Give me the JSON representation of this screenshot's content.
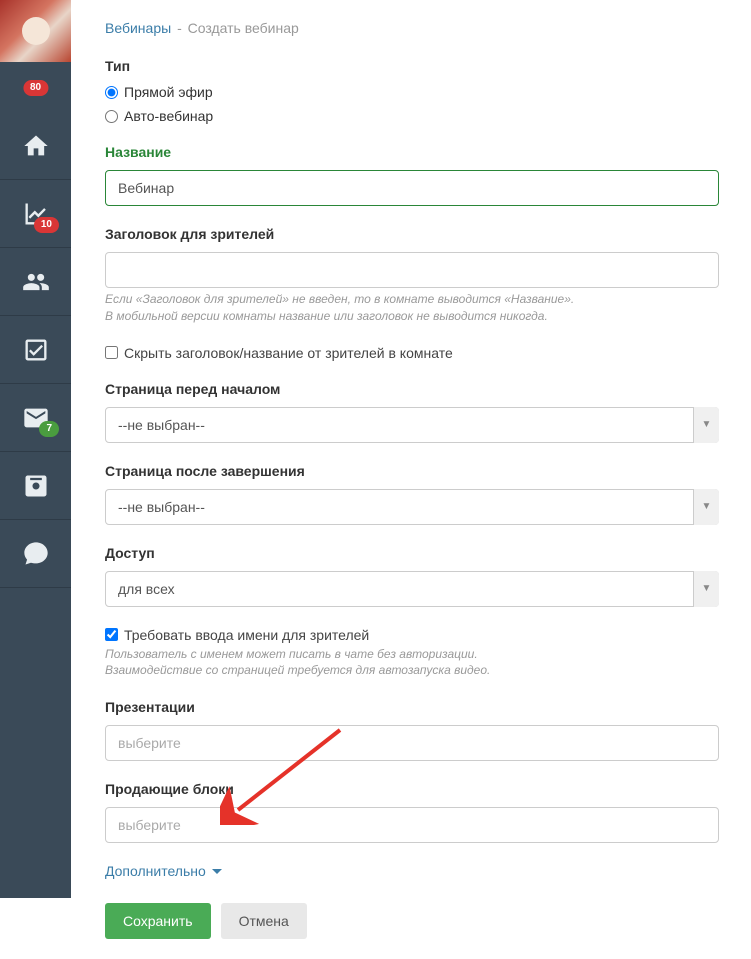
{
  "sidebar": {
    "badge1": "80",
    "badge_chart": "10",
    "badge_mail": "7"
  },
  "breadcrumb": {
    "link": "Вебинары",
    "sep": "-",
    "current": "Создать вебинар"
  },
  "type": {
    "label": "Тип",
    "options": [
      {
        "label": "Прямой эфир",
        "checked": true
      },
      {
        "label": "Авто-вебинар",
        "checked": false
      }
    ]
  },
  "name": {
    "label": "Название",
    "value": "Вебинар"
  },
  "viewer_title": {
    "label": "Заголовок для зрителей",
    "value": "",
    "hint1": "Если «Заголовок для зрителей» не введен, то в комнате выводится «Название».",
    "hint2": "В мобильной версии комнаты название или заголовок не выводится никогда."
  },
  "hide_title": {
    "label": "Скрыть заголовок/название от зрителей в комнате",
    "checked": false
  },
  "page_before": {
    "label": "Страница перед началом",
    "value": "--не выбран--"
  },
  "page_after": {
    "label": "Страница после завершения",
    "value": "--не выбран--"
  },
  "access": {
    "label": "Доступ",
    "value": "для всех"
  },
  "require_name": {
    "label": "Требовать ввода имени для зрителей",
    "checked": true,
    "hint1": "Пользователь с именем может писать в чате без авторизации.",
    "hint2": "Взаимодействие со страницей требуется для автозапуска видео."
  },
  "presentations": {
    "label": "Презентации",
    "placeholder": "выберите"
  },
  "selling_blocks": {
    "label": "Продающие блоки",
    "placeholder": "выберите"
  },
  "additional": {
    "label": "Дополнительно"
  },
  "buttons": {
    "save": "Сохранить",
    "cancel": "Отмена"
  }
}
